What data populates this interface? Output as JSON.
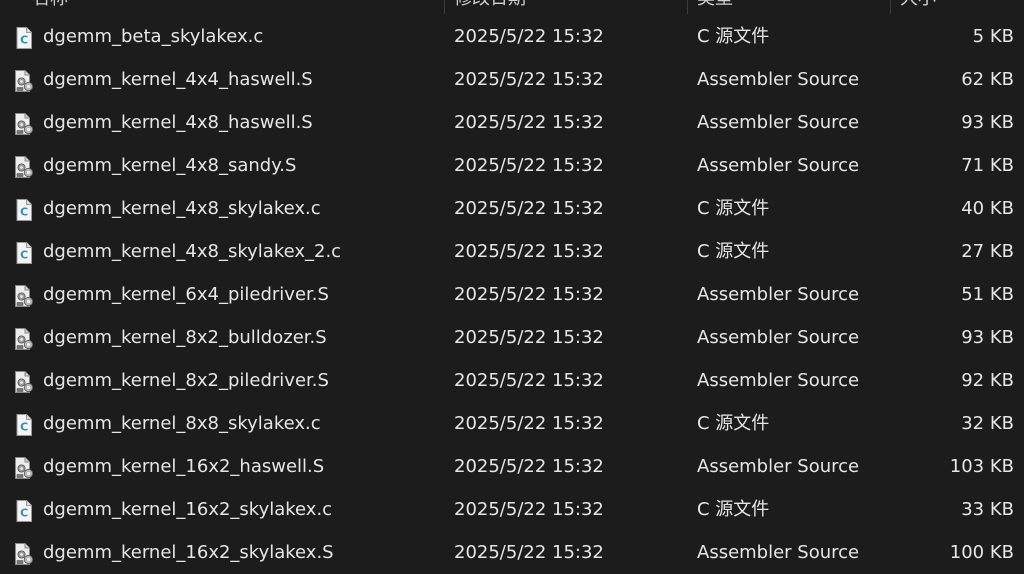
{
  "header": {
    "name_label": "名称",
    "date_label": "修改日期",
    "type_label": "类型",
    "size_label": "大小"
  },
  "colors": {
    "background": "#1c1c1c",
    "text": "#e6e6e6",
    "c_icon_accent": "#2f8fb7"
  },
  "files": [
    {
      "name": "dgemm_beta_skylakex.c",
      "date": "2025/5/22 15:32",
      "type": "C 源文件",
      "size": "5 KB",
      "icon": "c-file-icon"
    },
    {
      "name": "dgemm_kernel_4x4_haswell.S",
      "date": "2025/5/22 15:32",
      "type": "Assembler Source",
      "size": "62 KB",
      "icon": "assembler-file-icon"
    },
    {
      "name": "dgemm_kernel_4x8_haswell.S",
      "date": "2025/5/22 15:32",
      "type": "Assembler Source",
      "size": "93 KB",
      "icon": "assembler-file-icon"
    },
    {
      "name": "dgemm_kernel_4x8_sandy.S",
      "date": "2025/5/22 15:32",
      "type": "Assembler Source",
      "size": "71 KB",
      "icon": "assembler-file-icon"
    },
    {
      "name": "dgemm_kernel_4x8_skylakex.c",
      "date": "2025/5/22 15:32",
      "type": "C 源文件",
      "size": "40 KB",
      "icon": "c-file-icon"
    },
    {
      "name": "dgemm_kernel_4x8_skylakex_2.c",
      "date": "2025/5/22 15:32",
      "type": "C 源文件",
      "size": "27 KB",
      "icon": "c-file-icon"
    },
    {
      "name": "dgemm_kernel_6x4_piledriver.S",
      "date": "2025/5/22 15:32",
      "type": "Assembler Source",
      "size": "51 KB",
      "icon": "assembler-file-icon"
    },
    {
      "name": "dgemm_kernel_8x2_bulldozer.S",
      "date": "2025/5/22 15:32",
      "type": "Assembler Source",
      "size": "93 KB",
      "icon": "assembler-file-icon"
    },
    {
      "name": "dgemm_kernel_8x2_piledriver.S",
      "date": "2025/5/22 15:32",
      "type": "Assembler Source",
      "size": "92 KB",
      "icon": "assembler-file-icon"
    },
    {
      "name": "dgemm_kernel_8x8_skylakex.c",
      "date": "2025/5/22 15:32",
      "type": "C 源文件",
      "size": "32 KB",
      "icon": "c-file-icon"
    },
    {
      "name": "dgemm_kernel_16x2_haswell.S",
      "date": "2025/5/22 15:32",
      "type": "Assembler Source",
      "size": "103 KB",
      "icon": "assembler-file-icon"
    },
    {
      "name": "dgemm_kernel_16x2_skylakex.c",
      "date": "2025/5/22 15:32",
      "type": "C 源文件",
      "size": "33 KB",
      "icon": "c-file-icon"
    },
    {
      "name": "dgemm_kernel_16x2_skylakex.S",
      "date": "2025/5/22 15:32",
      "type": "Assembler Source",
      "size": "100 KB",
      "icon": "assembler-file-icon"
    }
  ]
}
